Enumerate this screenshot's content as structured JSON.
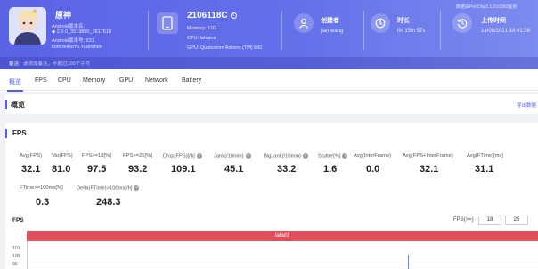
{
  "colors": {
    "header_gradient_start": "#5b63e6",
    "header_gradient_end": "#7c8bef",
    "accent": "#4e5cff",
    "label_bar": "#e0505c"
  },
  "header": {
    "top_note": "数据由PerfDog5.1.210393提供",
    "app": {
      "name": "原神",
      "icon": "game-character-icon",
      "line1": "Android版本名:",
      "line2": "◆ 2.0.0_3513880_3617618",
      "line3": "Android版本号: 231",
      "line4": "com.miHoYo.Yuanshen"
    },
    "device": {
      "icon": "phone-icon",
      "title": "2106118C",
      "memory": "Memory: 11G",
      "cpu": "CPU: lahaina",
      "gpu": "GPU: Qualcomm Adreno (TM) 660"
    },
    "creator": {
      "icon": "user-icon",
      "label": "创建者",
      "value": "jian wang"
    },
    "duration": {
      "icon": "clock-icon",
      "label": "时长",
      "value": "0h 15m 57s"
    },
    "upload": {
      "icon": "history-icon",
      "label": "上传时间",
      "value": "14/08/2021 16:41:36"
    },
    "note_label": "备注:",
    "note_placeholder": "请添加备注，不超过100个字符"
  },
  "tabs": [
    {
      "label": "概览",
      "active": true
    },
    {
      "label": "FPS"
    },
    {
      "label": "CPU"
    },
    {
      "label": "Memory"
    },
    {
      "label": "GPU"
    },
    {
      "label": "Network"
    },
    {
      "label": "Battery"
    }
  ],
  "overview": {
    "title": "概览",
    "export": "导出数据"
  },
  "fps": {
    "title": "FPS",
    "metrics_row1": [
      {
        "label": "Avg(FPS)",
        "value": "32.1"
      },
      {
        "label": "Var(FPS)",
        "value": "81.0"
      },
      {
        "label": "FPS>=18[%]",
        "value": "97.5"
      },
      {
        "label": "FPS>=25[%]",
        "value": "93.2"
      },
      {
        "label": "Drop(FPS)[/h]",
        "value": "109.1"
      },
      {
        "label": "Jank(/10min)",
        "value": "45.1"
      },
      {
        "label": "BigJank(/10min)",
        "value": "33.2"
      },
      {
        "label": "Stutter[%]",
        "value": "1.6"
      },
      {
        "label": "Avg(InterFrame)",
        "value": "0.0"
      },
      {
        "label": "Avg(FPS+InterFrame)",
        "value": "32.1"
      },
      {
        "label": "Avg(FTime)[ms]",
        "value": "31.1"
      }
    ],
    "metrics_row2": [
      {
        "label": "FTime>=100ms[%]",
        "value": "0.3"
      },
      {
        "label": "Delta(FTime)>100ms[/h]",
        "value": "248.3"
      }
    ],
    "chart": {
      "title": "FPS",
      "range_label": "FPS(>=)",
      "range_min": "18",
      "range_max": "25",
      "label_bar": "label1",
      "y_ticks": [
        "110",
        "100",
        "90"
      ]
    }
  }
}
